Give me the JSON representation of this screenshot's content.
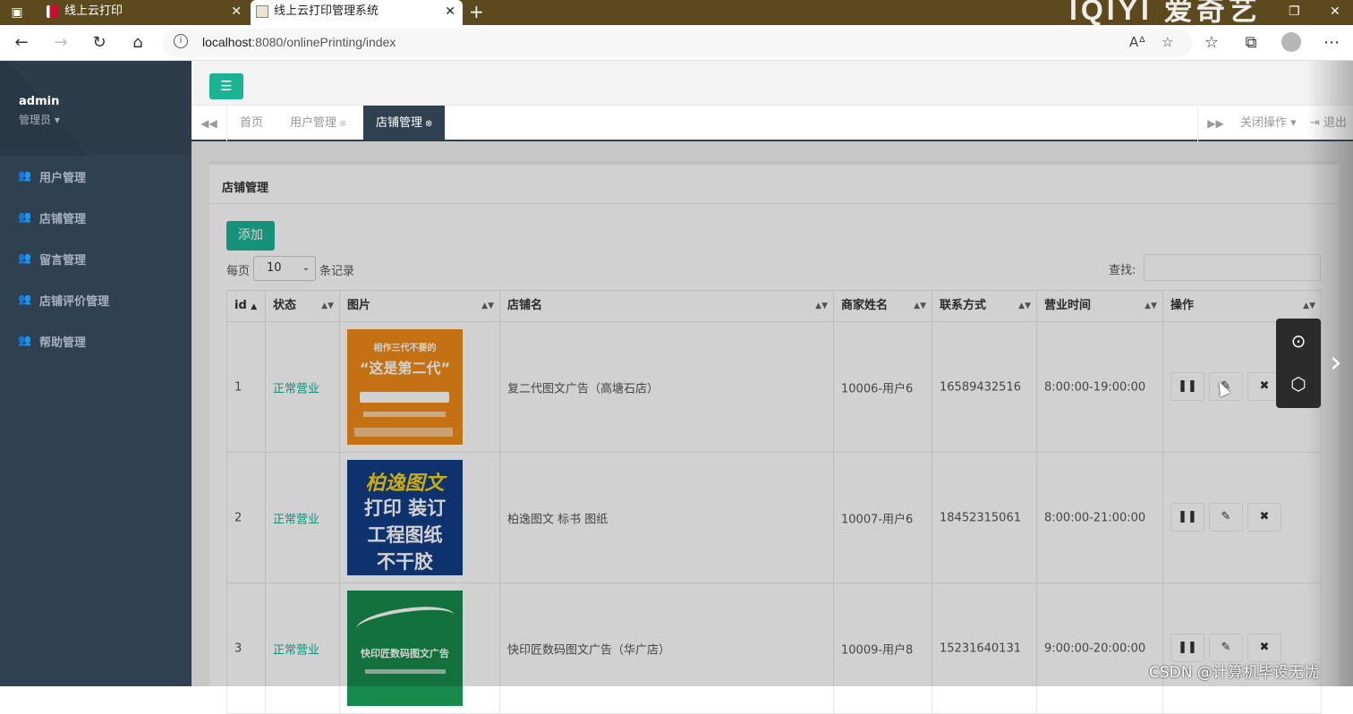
{
  "browser": {
    "tabs": [
      {
        "title": "线上云打印",
        "close": "✕"
      },
      {
        "title": "线上云打印管理系统",
        "close": "✕"
      }
    ],
    "new_tab": "+",
    "url_host": "localhost",
    "url_path": ":8080/onlinePrinting/index",
    "window_logo": "IQIYI 爱奇艺"
  },
  "user": {
    "name": "admin",
    "role": "管理员"
  },
  "sidebar": {
    "items": [
      {
        "label": "用户管理",
        "icon": "users-icon"
      },
      {
        "label": "店铺管理",
        "icon": "users-icon"
      },
      {
        "label": "留言管理",
        "icon": "users-icon"
      },
      {
        "label": "店铺评价管理",
        "icon": "users-icon"
      },
      {
        "label": "帮助管理",
        "icon": "users-icon"
      }
    ]
  },
  "page_tabs": {
    "items": [
      {
        "label": "首页",
        "closable": false
      },
      {
        "label": "用户管理",
        "closable": true
      },
      {
        "label": "店铺管理",
        "closable": true,
        "active": true
      }
    ],
    "close_ops": "关闭操作",
    "logout": "退出"
  },
  "panel": {
    "title": "店铺管理",
    "add_button": "添加",
    "per_page_prefix": "每页",
    "per_page_value": "10",
    "per_page_suffix": "条记录",
    "search_label": "查找:"
  },
  "table": {
    "columns": [
      "id",
      "状态",
      "图片",
      "店铺名",
      "商家姓名",
      "联系方式",
      "营业时间",
      "操作"
    ],
    "rows": [
      {
        "id": "1",
        "status": "正常营业",
        "shop": "复二代图文广告（高塘石店）",
        "owner": "10006-用户6",
        "phone": "16589432516",
        "hours": "8:00:00-19:00:00",
        "image": {
          "lines": [
            "相作三代不要的",
            "“这是第二代”"
          ],
          "color": "#f08a18"
        }
      },
      {
        "id": "2",
        "status": "正常营业",
        "shop": "柏逸图文 标书 图纸",
        "owner": "10007-用户6",
        "phone": "18452315061",
        "hours": "8:00:00-21:00:00",
        "image": {
          "lines": [
            "柏逸图文",
            "打印 装订",
            "工程图纸",
            "不干胶"
          ],
          "color": "#123e85"
        }
      },
      {
        "id": "3",
        "status": "正常营业",
        "shop": "快印匠数码图文广告（华广店）",
        "owner": "10009-用户8",
        "phone": "15231640131",
        "hours": "9:00:00-20:00:00",
        "image": {
          "lines": [
            "快印匠数码图文广告"
          ],
          "color": "#168a4a"
        }
      }
    ]
  },
  "overlay": {
    "watermark": "CSDN @计算机毕设无忧"
  },
  "colors": {
    "sidebar": "#2f4050",
    "accent": "#1ab394",
    "browser_bar": "#5c4a1e"
  }
}
